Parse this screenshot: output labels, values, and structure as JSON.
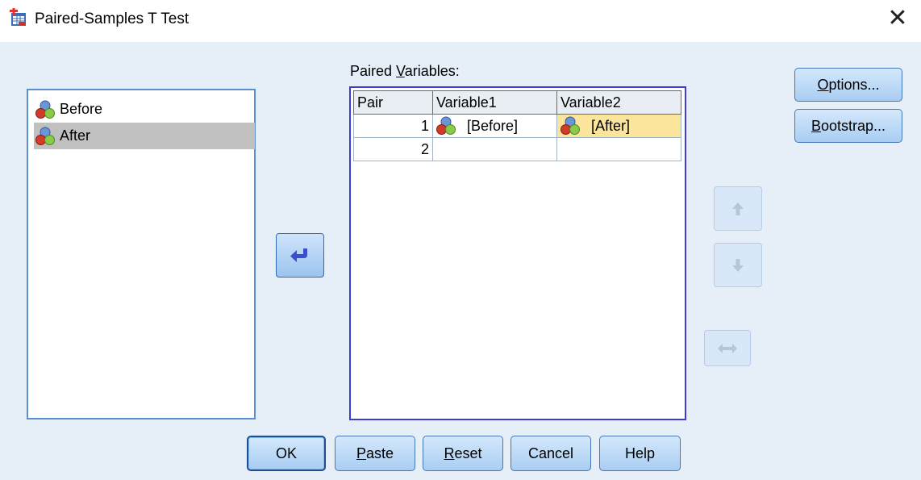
{
  "window": {
    "title": "Paired-Samples T Test",
    "close_glyph": "✕"
  },
  "source_list": {
    "items": [
      {
        "label": "Before",
        "icon": "scale-variable-icon",
        "selected": false
      },
      {
        "label": "After",
        "icon": "scale-variable-icon",
        "selected": true
      }
    ]
  },
  "paired": {
    "label_pre": "Paired ",
    "label_mnemonic": "V",
    "label_post": "ariables:",
    "columns": [
      "Pair",
      "Variable1",
      "Variable2"
    ],
    "rows": [
      {
        "pair": "1",
        "var1": "[Before]",
        "var2": "[After]"
      },
      {
        "pair": "2",
        "var1": "",
        "var2": ""
      }
    ]
  },
  "side_buttons": {
    "options": {
      "mnemonic": "O",
      "rest": "ptions..."
    },
    "bootstrap": {
      "mnemonic": "B",
      "rest": "ootstrap..."
    }
  },
  "bottom_buttons": {
    "ok": "OK",
    "paste": {
      "mnemonic": "P",
      "rest": "aste"
    },
    "reset": {
      "mnemonic": "R",
      "rest": "eset"
    },
    "cancel": "Cancel",
    "help": "Help"
  },
  "colors": {
    "accent": "#3c3cd0",
    "highlight": "#fbe49c",
    "client_bg": "#e6eef8"
  }
}
